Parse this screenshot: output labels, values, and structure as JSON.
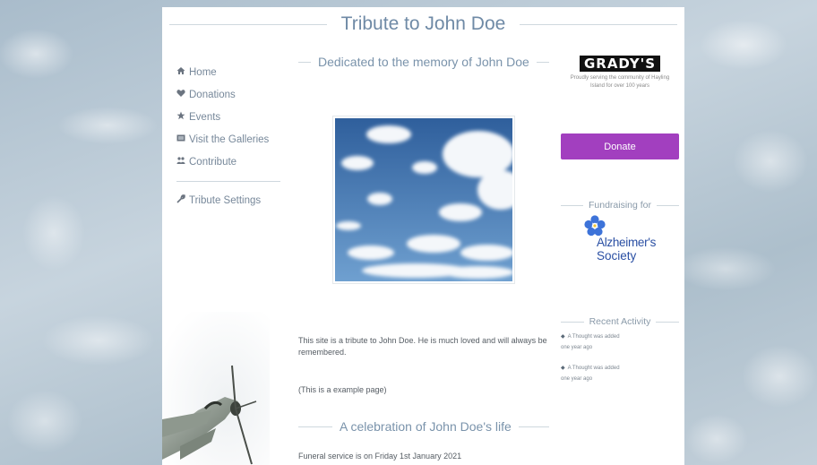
{
  "header": {
    "title": "Tribute to John Doe"
  },
  "nav": {
    "items": [
      {
        "label": "Home",
        "icon": "home-icon",
        "glyph": "🏠"
      },
      {
        "label": "Donations",
        "icon": "heart-icon",
        "glyph": "♥"
      },
      {
        "label": "Events",
        "icon": "star-icon",
        "glyph": "★"
      },
      {
        "label": "Visit the Galleries",
        "icon": "gallery-icon",
        "glyph": "▦"
      },
      {
        "label": "Contribute",
        "icon": "people-icon",
        "glyph": "♣"
      }
    ],
    "settings": {
      "label": "Tribute Settings",
      "icon": "wrench-icon",
      "glyph": "🔧"
    }
  },
  "main": {
    "dedication": "Dedicated to the memory of John Doe",
    "intro_line1": "This site is a tribute to John Doe. He is much loved and will always be",
    "intro_line2": "remembered.",
    "example_note": "(This is a example page)",
    "celebration_title": "A celebration of John Doe's life",
    "funeral_text": "Funeral service is on Friday 1st January 2021"
  },
  "sponsor": {
    "logo_text": "GRADY'S",
    "tagline_line1": "Proudly serving the community of Hayling",
    "tagline_line2": "Island for over 100 years"
  },
  "donate": {
    "label": "Donate",
    "color": "#a23fbf"
  },
  "fundraising": {
    "heading": "Fundraising for",
    "charity_line1": "Alzheimer's",
    "charity_line2": "Society",
    "charity_color": "#2a4fa3"
  },
  "recent_activity": {
    "heading": "Recent Activity",
    "items": [
      {
        "text": "A Thought was added",
        "time": "one year ago"
      },
      {
        "text": "A Thought was added",
        "time": "one year ago"
      }
    ]
  }
}
